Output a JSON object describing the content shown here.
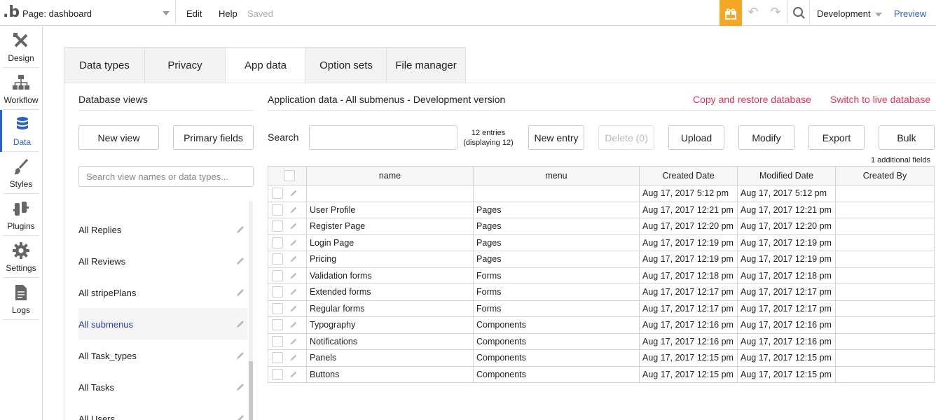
{
  "topbar": {
    "logo": ".b",
    "page_label": "Page: dashboard",
    "menu_edit": "Edit",
    "menu_help": "Help",
    "status": "Saved",
    "environment": "Development",
    "preview": "Preview"
  },
  "nav": {
    "items": [
      {
        "label": "Design",
        "icon": "design-icon"
      },
      {
        "label": "Workflow",
        "icon": "workflow-icon"
      },
      {
        "label": "Data",
        "icon": "database-icon"
      },
      {
        "label": "Styles",
        "icon": "brush-icon"
      },
      {
        "label": "Plugins",
        "icon": "plug-icon"
      },
      {
        "label": "Settings",
        "icon": "gear-icon"
      },
      {
        "label": "Logs",
        "icon": "document-icon"
      }
    ],
    "active": "Data"
  },
  "tabs": [
    "Data types",
    "Privacy",
    "App data",
    "Option sets",
    "File manager"
  ],
  "active_tab": "App data",
  "database_views": {
    "title": "Database views",
    "new_view": "New view",
    "primary_fields": "Primary fields",
    "search_placeholder": "Search view names or data types...",
    "items": [
      "All Replies",
      "All Reviews",
      "All stripePlans",
      "All submenus",
      "All Task_types",
      "All Tasks",
      "All Users"
    ],
    "active_item": "All submenus"
  },
  "app_data": {
    "title": "Application data - All submenus - Development version",
    "copy_restore": "Copy and restore database",
    "switch_live": "Switch to live database",
    "search_label": "Search",
    "entries_line1": "12 entries",
    "entries_line2": "(displaying 12)",
    "new_entry": "New entry",
    "delete": "Delete (0)",
    "upload": "Upload",
    "modify": "Modify",
    "export": "Export",
    "bulk": "Bulk",
    "additional_fields": "1 additional fields"
  },
  "table": {
    "columns": [
      "name",
      "menu",
      "Created Date",
      "Modified Date",
      "Created By"
    ],
    "rows": [
      {
        "name": "",
        "menu": "",
        "created": "Aug 17, 2017 5:12 pm",
        "modified": "Aug 17, 2017 5:12 pm",
        "by": ""
      },
      {
        "name": "User Profile",
        "menu": "Pages",
        "created": "Aug 17, 2017 12:21 pm",
        "modified": "Aug 17, 2017 12:21 pm",
        "by": ""
      },
      {
        "name": "Register Page",
        "menu": "Pages",
        "created": "Aug 17, 2017 12:20 pm",
        "modified": "Aug 17, 2017 12:20 pm",
        "by": ""
      },
      {
        "name": "Login Page",
        "menu": "Pages",
        "created": "Aug 17, 2017 12:19 pm",
        "modified": "Aug 17, 2017 12:19 pm",
        "by": ""
      },
      {
        "name": "Pricing",
        "menu": "Pages",
        "created": "Aug 17, 2017 12:19 pm",
        "modified": "Aug 17, 2017 12:19 pm",
        "by": ""
      },
      {
        "name": "Validation forms",
        "menu": "Forms",
        "created": "Aug 17, 2017 12:18 pm",
        "modified": "Aug 17, 2017 12:18 pm",
        "by": ""
      },
      {
        "name": "Extended forms",
        "menu": "Forms",
        "created": "Aug 17, 2017 12:17 pm",
        "modified": "Aug 17, 2017 12:17 pm",
        "by": ""
      },
      {
        "name": "Regular forms",
        "menu": "Forms",
        "created": "Aug 17, 2017 12:17 pm",
        "modified": "Aug 17, 2017 12:17 pm",
        "by": ""
      },
      {
        "name": "Typography",
        "menu": "Components",
        "created": "Aug 17, 2017 12:16 pm",
        "modified": "Aug 17, 2017 12:16 pm",
        "by": ""
      },
      {
        "name": "Notifications",
        "menu": "Components",
        "created": "Aug 17, 2017 12:16 pm",
        "modified": "Aug 17, 2017 12:16 pm",
        "by": ""
      },
      {
        "name": "Panels",
        "menu": "Components",
        "created": "Aug 17, 2017 12:15 pm",
        "modified": "Aug 17, 2017 12:15 pm",
        "by": ""
      },
      {
        "name": "Buttons",
        "menu": "Components",
        "created": "Aug 17, 2017 12:15 pm",
        "modified": "Aug 17, 2017 12:15 pm",
        "by": ""
      }
    ]
  },
  "colors": {
    "accent_blue": "#2d5fc9",
    "link_red": "#e0335a",
    "gift_orange": "#f5a623"
  }
}
